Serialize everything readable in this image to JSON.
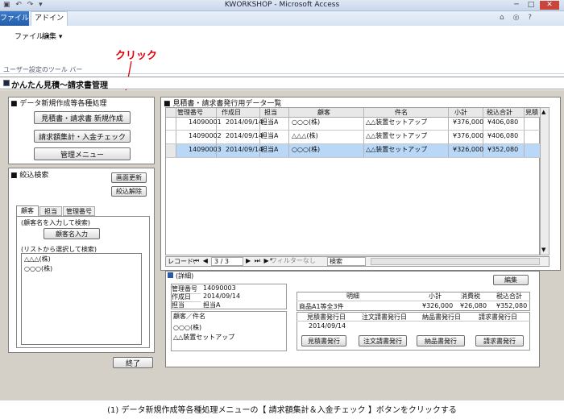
{
  "window": {
    "app_title": "KWORKSHOP - Microsoft Access",
    "min_icon": "minimize-icon",
    "max_icon": "maximize-icon",
    "close_icon": "close-icon"
  },
  "ribbon": {
    "tabs": [
      "ファイル",
      "アドイン"
    ],
    "menu_items": [
      "ファイル ▾",
      "編集 ▾"
    ],
    "group_label": "ユーザー設定のツール バー"
  },
  "annotation": {
    "label": "クリック",
    "color": "#e0000b"
  },
  "form": {
    "title": "かんたん見積〜請求書管理",
    "left": {
      "section_data_label": "■ データ新規作成等各種処理",
      "btn_new_estimate": "見積書・請求書 新規作成",
      "btn_billing_check": "請求額集計・入金チェック",
      "btn_admin_menu": "管理メニュー",
      "section_filter_label": "■ 絞込検索",
      "btn_refresh": "画面更新",
      "btn_clear_filter": "絞込解除",
      "tabs": [
        "顧客",
        "担当",
        "管理番号"
      ],
      "customer_hint": "(顧客名を入力して検索)",
      "btn_customer_input": "顧客名入力",
      "list_hint": "(リストから選択して検索)",
      "customer_list": [
        "△△△(株)",
        "○○○(株)"
      ],
      "btn_exit": "終了"
    },
    "datasheet": {
      "title": "■ 見積書・請求書発行用データ一覧",
      "columns": [
        "管理番号",
        "作成日",
        "担当",
        "顧客",
        "件名",
        "小計",
        "税込合計",
        "見積"
      ],
      "rows": [
        {
          "id": "14090001",
          "date": "2014/09/14",
          "staff": "担当A",
          "customer": "○○○(株)",
          "subject": "△△装置セットアップ",
          "subtotal": "¥376,000",
          "total": "¥406,080"
        },
        {
          "id": "14090002",
          "date": "2014/09/14",
          "staff": "担当A",
          "customer": "△△△(株)",
          "subject": "△△装置セットアップ",
          "subtotal": "¥376,000",
          "total": "¥406,080"
        },
        {
          "id": "14090003",
          "date": "2014/09/14",
          "staff": "担当A",
          "customer": "○○○(株)",
          "subject": "△△装置セットアップ",
          "subtotal": "¥326,000",
          "total": "¥352,080"
        }
      ],
      "nav_record_label": "レコード:",
      "nav_position": "3 / 3",
      "nav_filter": "フィルターなし",
      "nav_search": "検索"
    },
    "detail": {
      "title": "(詳細)",
      "btn_edit": "編集",
      "fields": [
        {
          "label": "管理番号",
          "value": "14090003"
        },
        {
          "label": "作成日",
          "value": "2014/09/14"
        },
        {
          "label": "担当",
          "value": "担当A"
        }
      ],
      "customer_subject_label": "顧客／件名",
      "customer_value": "○○○(株)",
      "subject_value": "△△装置セットアップ",
      "breakdown_header": "明細",
      "subtotal_header": "小計",
      "tax_header": "消費税",
      "total_header": "税込合計",
      "item_desc": "商品A1等全3件",
      "item_subtotal": "¥326,000",
      "item_tax": "¥26,080",
      "item_total": "¥352,080",
      "issue_headers": [
        "見積書発行日",
        "注文請書発行日",
        "納品書発行日",
        "請求書発行日"
      ],
      "estimate_issue_date": "2014/09/14",
      "issue_buttons": [
        "見積書発行",
        "注文請書発行",
        "納品書発行",
        "請求書発行"
      ]
    }
  },
  "caption": "(1) データ新規作成等各種処理メニューの【 請求額集計＆入金チェック 】ボタンをクリックする"
}
